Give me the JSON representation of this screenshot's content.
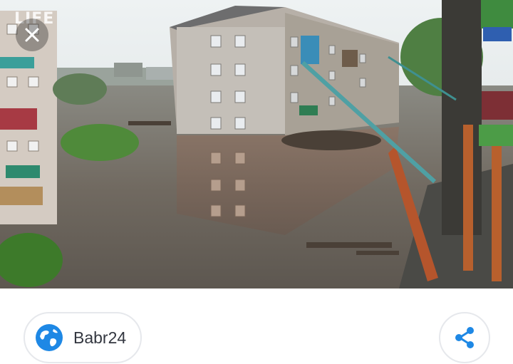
{
  "photo": {
    "alt_icon_name": "flooded-town-photo",
    "watermark": "LIFE",
    "close_icon": "close-icon"
  },
  "source": {
    "name": "Babr24",
    "icon": "globe-icon",
    "accent": "#1e88e5"
  },
  "share": {
    "icon": "share-icon",
    "accent": "#1e88e5"
  }
}
